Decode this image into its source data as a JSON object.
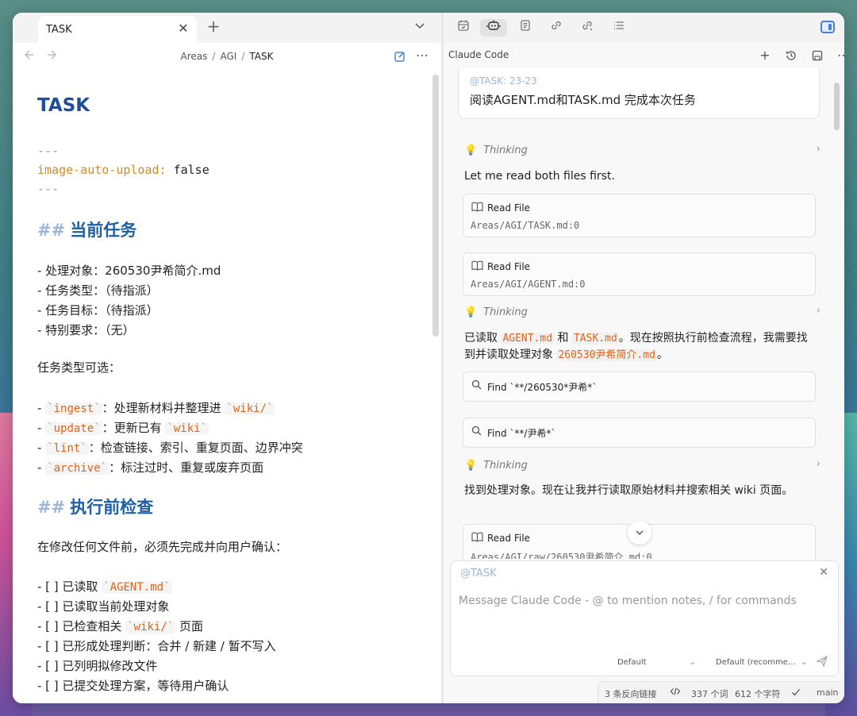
{
  "left_tab": {
    "title": "TASK",
    "close": "✕",
    "new": "+"
  },
  "breadcrumb": {
    "part1": "Areas",
    "part2": "AGI",
    "current": "TASK",
    "sep": "/"
  },
  "doc": {
    "title": "TASK",
    "frontmatter_dash": "---",
    "frontmatter_key": "image-auto-upload:",
    "frontmatter_val": "false",
    "h2_hash": "##",
    "section1_title": "当前任务",
    "items": [
      "- 处理对象：260530尹希简介.md",
      "- 任务类型：（待指派）",
      "- 任务目标：（待指派）",
      "- 特别要求：（无）"
    ],
    "types_intro": "任务类型可选：",
    "types": [
      {
        "code": "ingest",
        "text": "：处理新材料并整理进 ",
        "code2": "wiki/"
      },
      {
        "code": "update",
        "text": "：更新已有 ",
        "code2": "wiki"
      },
      {
        "code": "lint",
        "text": "：检查链接、索引、重复页面、边界冲突",
        "code2": ""
      },
      {
        "code": "archive",
        "text": "：标注过时、重复或废弃页面",
        "code2": ""
      }
    ],
    "section2_title": "执行前检查",
    "check_intro": "在修改任何文件前，必须先完成并向用户确认：",
    "checks": [
      {
        "pre": "- [ ] 已读取 ",
        "code": "AGENT.md",
        "post": ""
      },
      {
        "pre": "- [ ] 已读取当前处理对象",
        "code": "",
        "post": ""
      },
      {
        "pre": "- [ ] 已检查相关 ",
        "code": "wiki/",
        "post": " 页面"
      },
      {
        "pre": "- [ ] 已形成处理判断：合并 / 新建 / 暂不写入",
        "code": "",
        "post": ""
      },
      {
        "pre": "- [ ] 已列明拟修改文件",
        "code": "",
        "post": ""
      },
      {
        "pre": "- [ ] 已提交处理方案，等待用户确认",
        "code": "",
        "post": ""
      }
    ]
  },
  "right_header": {
    "title": "Claude Code"
  },
  "chat": {
    "user_mention": "@TASK: 23-23",
    "user_text": "阅读AGENT.md和TASK.md 完成本次任务",
    "thinking_label": "Thinking",
    "msg1": "Let me read both files first.",
    "read_label": "Read File",
    "read1_path": "Areas/AGI/TASK.md:0",
    "read2_path": "Areas/AGI/AGENT.md:0",
    "msg2_a": "已读取 ",
    "msg2_code1": "AGENT.md",
    "msg2_b": " 和 ",
    "msg2_code2": "TASK.md",
    "msg2_c": "。现在按照执行前检查流程，我需要找到并读取处理对象 ",
    "msg2_code3": "260530尹希简介.md",
    "msg2_d": "。",
    "find1": "Find `**/260530*尹希*`",
    "find2": "Find `**/尹希*`",
    "msg3": "找到处理对象。现在让我并行读取原始材料并搜索相关 wiki 页面。",
    "read3_path": "Areas/AGI/raw/260530尹希简介.md:0"
  },
  "composer": {
    "mention": "@TASK",
    "placeholder": "Message Claude Code - @ to mention notes, / for commands",
    "model": "Default",
    "mode": "Default (recomme…"
  },
  "status": {
    "backlinks": "3 条反向链接",
    "words": "337 个词",
    "chars": "612 个字符",
    "branch": "main"
  },
  "colors": {
    "accent": "#1e5fa6",
    "code": "#e0641a",
    "frontmatter_key": "#d08a2a"
  }
}
